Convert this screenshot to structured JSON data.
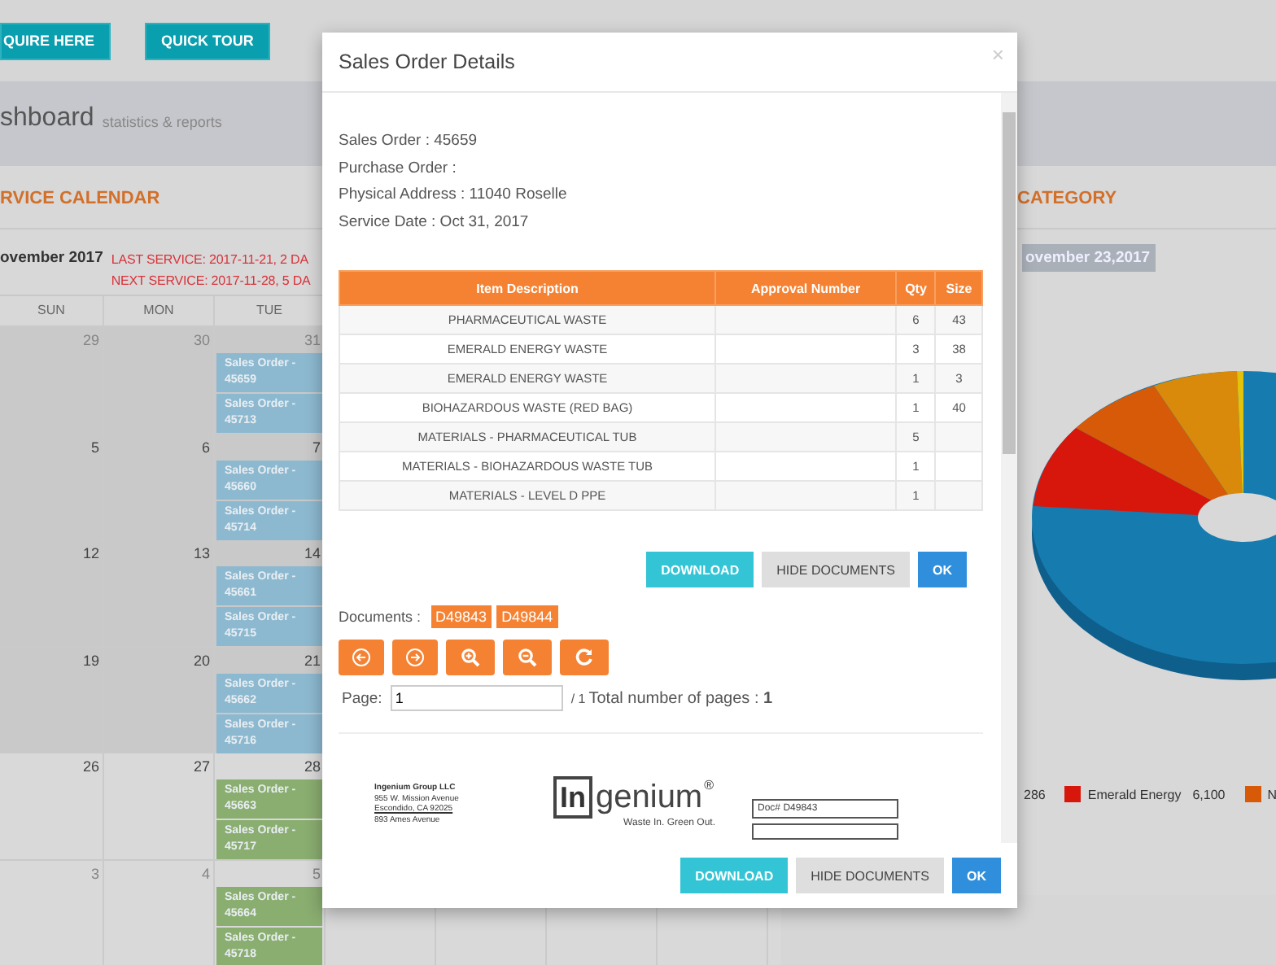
{
  "top_buttons": [
    "QUIRE HERE",
    "QUICK TOUR"
  ],
  "page_header": {
    "title": "shboard",
    "subtitle": "statistics & reports"
  },
  "calendar_panel": {
    "title": "RVICE CALENDAR",
    "month": "ovember 2017",
    "last_service": "LAST SERVICE: 2017-11-21, 2 DA",
    "next_service": "NEXT SERVICE: 2017-11-28, 5 DA",
    "columns": [
      "SUN",
      "MON",
      "TUE"
    ],
    "weeks": [
      {
        "past": true,
        "days": [
          {
            "day": "29",
            "other_month": true
          },
          {
            "day": "30",
            "other_month": true
          },
          {
            "day": "31",
            "other_month": true,
            "events": [
              {
                "label": "Sales Order - 45659",
                "color": "#8db9d0"
              },
              {
                "label": "Sales Order - 45713",
                "color": "#8db9d0"
              }
            ]
          }
        ]
      },
      {
        "past": true,
        "days": [
          {
            "day": "5",
            "other_month": false
          },
          {
            "day": "6",
            "other_month": false
          },
          {
            "day": "7",
            "other_month": false,
            "events": [
              {
                "label": "Sales Order - 45660",
                "color": "#8db9d0"
              },
              {
                "label": "Sales Order - 45714",
                "color": "#8db9d0"
              }
            ]
          }
        ]
      },
      {
        "past": true,
        "days": [
          {
            "day": "12",
            "other_month": false
          },
          {
            "day": "13",
            "other_month": false
          },
          {
            "day": "14",
            "other_month": false,
            "events": [
              {
                "label": "Sales Order - 45661",
                "color": "#8db9d0"
              },
              {
                "label": "Sales Order - 45715",
                "color": "#8db9d0"
              }
            ]
          }
        ]
      },
      {
        "past": true,
        "days": [
          {
            "day": "19",
            "other_month": false
          },
          {
            "day": "20",
            "other_month": false
          },
          {
            "day": "21",
            "other_month": false,
            "events": [
              {
                "label": "Sales Order - 45662",
                "color": "#8db9d0"
              },
              {
                "label": "Sales Order - 45716",
                "color": "#8db9d0"
              }
            ]
          }
        ]
      },
      {
        "past": false,
        "days": [
          {
            "day": "26",
            "other_month": false
          },
          {
            "day": "27",
            "other_month": false
          },
          {
            "day": "28",
            "other_month": false,
            "events": [
              {
                "label": "Sales Order - 45663",
                "color": "#8aad70"
              },
              {
                "label": "Sales Order - 45717",
                "color": "#8aad70"
              }
            ]
          }
        ]
      },
      {
        "past": false,
        "days": [
          {
            "day": "3",
            "other_month": true
          },
          {
            "day": "4",
            "other_month": true
          },
          {
            "day": "5",
            "other_month": true,
            "events": [
              {
                "label": "Sales Order - 45664",
                "color": "#8aad70"
              },
              {
                "label": "Sales Order - 45718",
                "color": "#8aad70"
              }
            ]
          }
        ]
      }
    ]
  },
  "category_panel": {
    "title": "CATEGORY",
    "date": "ovember 23,2017",
    "legend": [
      {
        "label": "286"
      },
      {
        "label": "Emerald Energy",
        "value": "6,100",
        "color": "#d7160c"
      },
      {
        "label": "N",
        "color": "#d65a08"
      }
    ]
  },
  "modal": {
    "title": "Sales Order Details",
    "close": "×",
    "info": [
      "Sales Order : 45659",
      "Purchase Order :",
      "Physical Address : 11040 Roselle",
      "Service Date : Oct 31, 2017"
    ],
    "table": {
      "columns": [
        "Item Description",
        "Approval Number",
        "Qty",
        "Size"
      ],
      "rows": [
        {
          "description": "PHARMACEUTICAL WASTE",
          "qty": "6",
          "size": "43"
        },
        {
          "description": "EMERALD ENERGY WASTE",
          "qty": "3",
          "size": "38"
        },
        {
          "description": "EMERALD ENERGY WASTE",
          "qty": "1",
          "size": "3"
        },
        {
          "description": "BIOHAZARDOUS WASTE (RED BAG)",
          "qty": "1",
          "size": "40"
        },
        {
          "description": "MATERIALS - PHARMACEUTICAL TUB",
          "qty": "5"
        },
        {
          "description": "MATERIALS - BIOHAZARDOUS WASTE TUB",
          "qty": "1"
        },
        {
          "description": "MATERIALS - LEVEL D PPE",
          "qty": "1"
        }
      ]
    },
    "actions": [
      {
        "label": "DOWNLOAD",
        "kind": "download"
      },
      {
        "label": "HIDE DOCUMENTS",
        "kind": "secondary"
      },
      {
        "label": "OK",
        "kind": "primary"
      }
    ],
    "documents_label": "Documents :",
    "documents": [
      "D49843",
      "D49844"
    ],
    "viewer_tools": [
      {
        "kind": "prev"
      },
      {
        "kind": "next"
      },
      {
        "kind": "zoom-in"
      },
      {
        "kind": "zoom-out"
      },
      {
        "kind": "rotate"
      }
    ],
    "page_label": "Page:",
    "page_value": "1",
    "page_total": "/ 1",
    "page_count_text": "Total number of pages : **1**",
    "document_preview": {
      "company": "Ingenium Group LLC",
      "address_lines": [
        "955 W. Mission Avenue",
        "Escondido, CA 92025",
        "893 Ames Avenue"
      ],
      "logo_box": "In",
      "logo_word": "genium",
      "logo_mark": "®",
      "tagline": "Waste In. Green Out.",
      "doc_number": "Doc# D49843"
    },
    "footer_actions": [
      {
        "label": "DOWNLOAD",
        "kind": "download"
      },
      {
        "label": "HIDE DOCUMENTS",
        "kind": "secondary"
      },
      {
        "label": "OK",
        "kind": "primary"
      }
    ]
  }
}
